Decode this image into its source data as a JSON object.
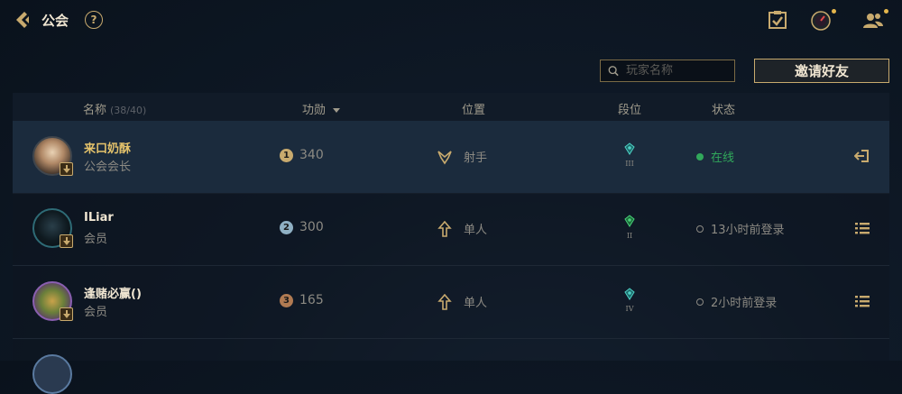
{
  "header": {
    "title": "公会",
    "help_label": "?"
  },
  "toolbar": {
    "search_placeholder": "玩家名称",
    "invite_label": "邀请好友"
  },
  "table": {
    "col_name": "名称",
    "col_name_count": "(38/40)",
    "col_merit": "功勋",
    "col_position": "位置",
    "col_tier": "段位",
    "col_status": "状态"
  },
  "rows": [
    {
      "name": "来口奶酥",
      "role": "公会会长",
      "merit_rank": "1",
      "merit": "340",
      "position": "射手",
      "tier": "III",
      "status": "在线"
    },
    {
      "name": "ILiar",
      "role": "会员",
      "merit_rank": "2",
      "merit": "300",
      "position": "单人",
      "tier": "II",
      "status": "13小时前登录"
    },
    {
      "name": "逢赌必赢()",
      "role": "会员",
      "merit_rank": "3",
      "merit": "165",
      "position": "单人",
      "tier": "IV",
      "status": "2小时前登录"
    }
  ],
  "colors": {
    "gold": "#c8aa6e",
    "online": "#31a85b",
    "background": "#0f1a28"
  }
}
